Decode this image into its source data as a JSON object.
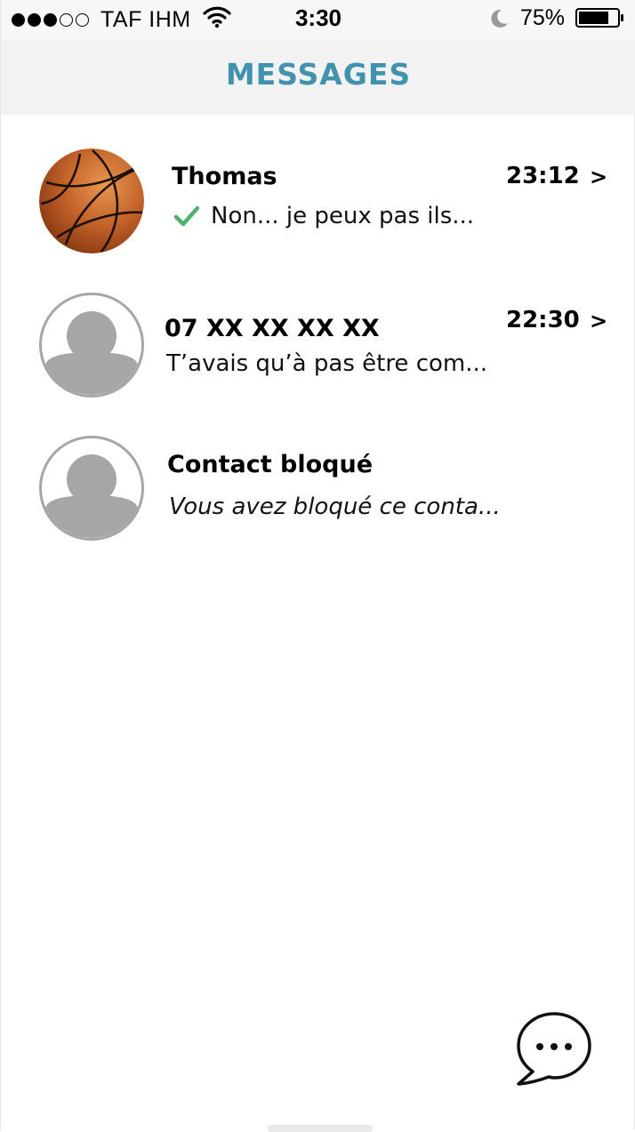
{
  "status_bar": {
    "carrier": "TAF IHM",
    "time": "3:30",
    "battery": "75%",
    "signal_icon": "signal-dots-icon",
    "wifi_icon": "wifi-icon",
    "dnd_icon": "moon-icon",
    "battery_icon": "battery-icon"
  },
  "header": {
    "title": "MESSAGES",
    "color": "#4193ad"
  },
  "conversations": [
    {
      "name": "Thomas",
      "preview": "Non... je peux pas ils...",
      "time": "23:12",
      "chevron": ">",
      "avatar": "basketball-icon",
      "status_icon": "checkmark-icon"
    },
    {
      "name": "07 XX XX XX XX",
      "preview": "T’avais qu’à pas être com...",
      "time": "22:30",
      "chevron": ">",
      "avatar": "person-placeholder-icon"
    },
    {
      "name": "Contact bloqué",
      "preview": "Vous avez bloqué ce conta...",
      "avatar": "person-placeholder-icon"
    }
  ],
  "compose": {
    "icon": "chat-bubble-ellipsis-icon"
  },
  "colors": {
    "check": "#4fb26a",
    "basketball": "#c2622a",
    "placeholder": "#a6a6a6"
  }
}
